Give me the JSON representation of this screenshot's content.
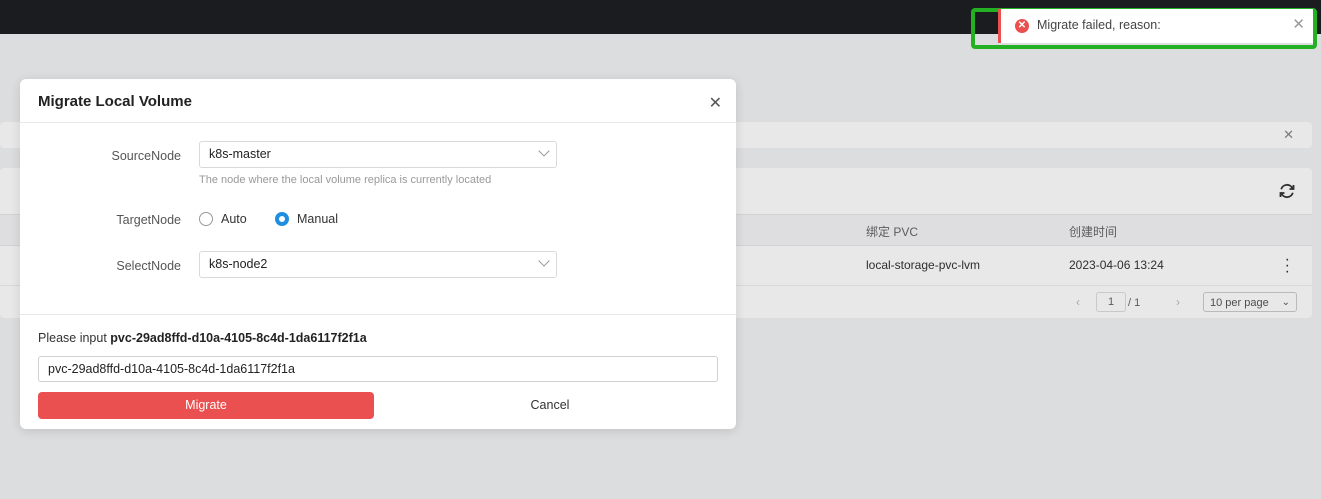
{
  "background_table": {
    "columns": [
      "绑定 PVC",
      "创建时间"
    ],
    "row": {
      "pvc": "local-storage-pvc-lvm",
      "created": "2023-04-06 13:24"
    },
    "pagination": {
      "page": "1",
      "total": "/ 1",
      "page_size": "10 per page"
    }
  },
  "modal": {
    "title": "Migrate Local Volume",
    "source_node": {
      "label": "SourceNode",
      "value": "k8s-master",
      "helper": "The node where the local volume replica is currently located"
    },
    "target_node": {
      "label": "TargetNode",
      "options": [
        "Auto",
        "Manual"
      ],
      "selected": "Manual"
    },
    "select_node": {
      "label": "SelectNode",
      "value": "k8s-node2"
    },
    "confirm": {
      "prompt": "Please input",
      "pvc_name": "pvc-29ad8ffd-d10a-4105-8c4d-1da6117f2f1a",
      "input_value": "pvc-29ad8ffd-d10a-4105-8c4d-1da6117f2f1a"
    },
    "buttons": {
      "migrate": "Migrate",
      "cancel": "Cancel"
    }
  },
  "toast": {
    "message": "Migrate failed, reason:",
    "icon": "error-icon",
    "close_glyph": "✕"
  },
  "colors": {
    "danger": "#e9504f",
    "primary": "#1e8fe0",
    "highlight": "#23b123"
  }
}
